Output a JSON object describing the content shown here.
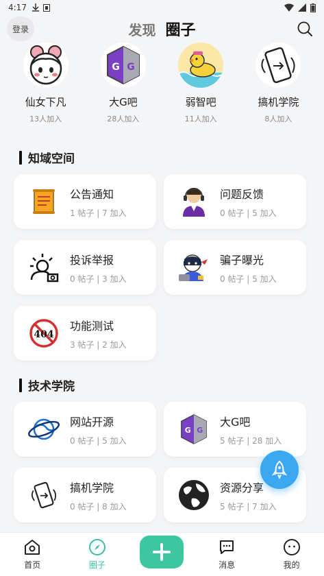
{
  "statusbar": {
    "time": "4:17"
  },
  "header": {
    "login_label": "登录",
    "tab_discover": "发现",
    "tab_circles": "圈子"
  },
  "featured": [
    {
      "name": "仙女下凡",
      "count": "13人加入",
      "icon": "fairy-girl-icon"
    },
    {
      "name": "大G吧",
      "count": "28人加入",
      "icon": "game-guardian-icon"
    },
    {
      "name": "弱智吧",
      "count": "11人加入",
      "icon": "rubber-duck-icon"
    },
    {
      "name": "搞机学院",
      "count": "8人加入",
      "icon": "phone-tinker-icon"
    }
  ],
  "sections": {
    "zhiyu": {
      "title": "知域空间",
      "cards": [
        {
          "title": "公告通知",
          "stats": "1 帖子 | 7 加入",
          "icon": "scroll-icon"
        },
        {
          "title": "问题反馈",
          "stats": "0 帖子 | 5 加入",
          "icon": "support-agent-icon"
        },
        {
          "title": "投诉举报",
          "stats": "0 帖子 | 3 加入",
          "icon": "report-user-icon"
        },
        {
          "title": "骗子曝光",
          "stats": "0 帖子 | 5 加入",
          "icon": "thief-icon"
        },
        {
          "title": "功能测试",
          "stats": "3 帖子 | 2 加入",
          "icon": "no-404-icon"
        }
      ]
    },
    "tech": {
      "title": "技术学院",
      "cards": [
        {
          "title": "网站开源",
          "stats": "0 帖子 | 5 加入",
          "icon": "planet-icon"
        },
        {
          "title": "大G吧",
          "stats": "5 帖子 | 28 加入",
          "icon": "game-guardian-icon"
        },
        {
          "title": "搞机学院",
          "stats": "0 帖子 | 8 加入",
          "icon": "phone-tinker-icon"
        },
        {
          "title": "资源分享",
          "stats": "5 帖子 | 7 加入",
          "icon": "globe-icon"
        }
      ]
    }
  },
  "nav": {
    "home": "首页",
    "circles": "圈子",
    "messages": "消息",
    "mine": "我的"
  },
  "colors": {
    "accent": "#3ec6a0",
    "fab": "#3aa7f0"
  }
}
